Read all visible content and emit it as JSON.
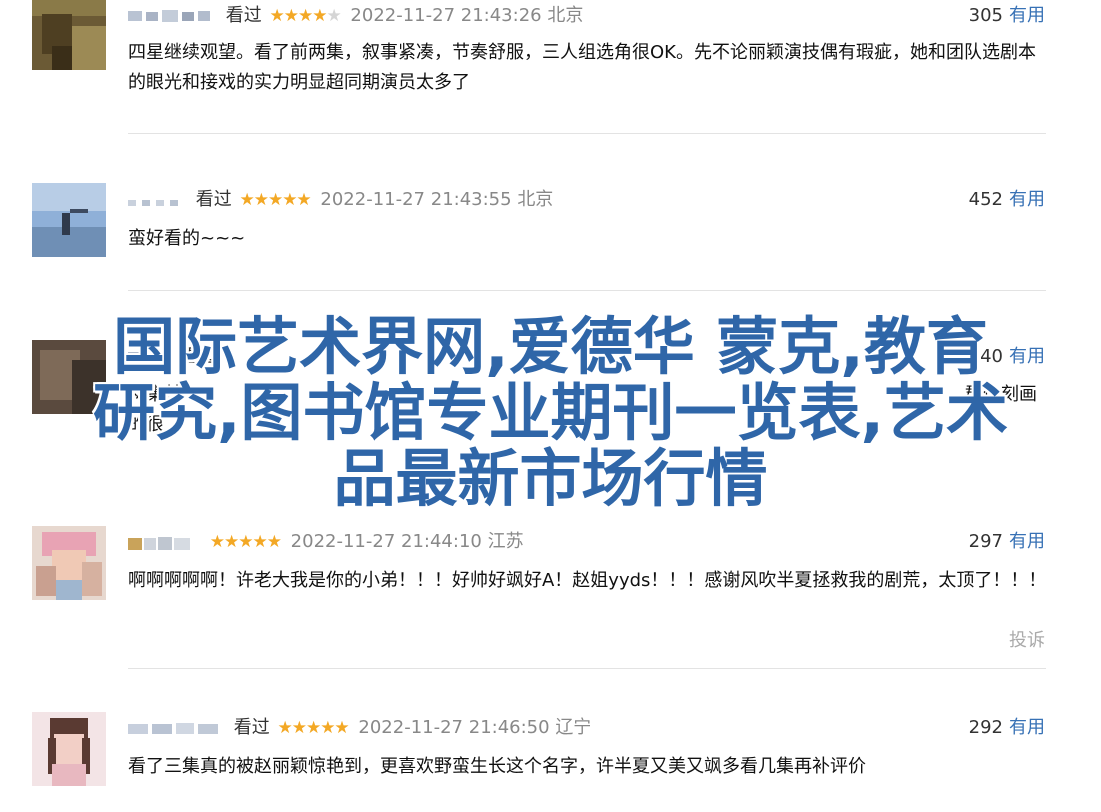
{
  "reviews": [
    {
      "watched": "看过",
      "stars": "★★★★",
      "stars_off": "★",
      "time": "2022-11-27 21:43:26",
      "location": "北京",
      "votes": "305",
      "useful": "有用",
      "content": "四星继续观望。看了前两集，叙事紧凑，节奏舒服，三人组选角很OK。先不论丽颖演技偶有瑕疵，她和团队选剧本的眼光和接戏的实力明显超同期演员太多了"
    },
    {
      "watched": "看过",
      "stars": "★★★★★",
      "stars_off": "",
      "time": "2022-11-27 21:43:55",
      "location": "北京",
      "votes": "452",
      "useful": "有用",
      "content": "蛮好看的~~~"
    },
    {
      "watched": "看过",
      "votes": "440",
      "useful": "有用",
      "content_line1": "两集基",
      "content_line1_end": "群像刻画",
      "content_line2": "的很"
    },
    {
      "watched": "",
      "stars": "★★★★★",
      "stars_off": "",
      "time": "2022-11-27 21:44:10",
      "location": "江苏",
      "votes": "297",
      "useful": "有用",
      "content": "啊啊啊啊啊！许老大我是你的小弟！！！好帅好飒好A！赵姐yyds！！！感谢风吹半夏拯救我的剧荒，太顶了！！！",
      "report": "投诉"
    },
    {
      "watched": "看过",
      "stars": "★★★★★",
      "stars_off": "",
      "time": "2022-11-27 21:46:50",
      "location": "辽宁",
      "votes": "292",
      "useful": "有用",
      "content": "看了三集真的被赵丽颖惊艳到，更喜欢野蛮生长这个名字，许半夏又美又飒多看几集再补评价"
    }
  ],
  "overlay": {
    "line1": "国际艺术界网,爱德华 蒙克,教育",
    "line2": "研究,图书馆专业期刊一览表,艺术",
    "line3": "品最新市场行情"
  }
}
